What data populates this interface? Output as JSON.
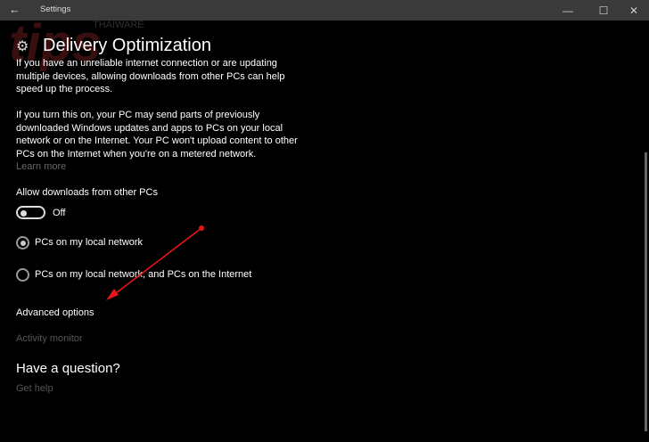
{
  "window": {
    "title": "Settings",
    "back": "←",
    "minimize": "—",
    "maximize": "☐",
    "close": "✕"
  },
  "watermark": {
    "brand": "THAIWARE",
    "logo": "tips"
  },
  "page": {
    "title": "Delivery Optimization",
    "para1": [
      "If you have an unreliable internet connection or are updating",
      "multiple devices, allowing downloads from other PCs can help",
      "speed up the process."
    ],
    "para2": [
      "If you turn this on, your PC may send parts of previously",
      "downloaded Windows updates and apps to PCs on your local",
      "network or on the Internet. Your PC won't upload content to other",
      "PCs on the Internet when you're on a metered network."
    ],
    "learn_more": "Learn more",
    "allow_label": "Allow downloads from other PCs",
    "toggle": {
      "state": "Off",
      "on": false
    },
    "radios": [
      {
        "label": "PCs on my local network",
        "selected": true
      },
      {
        "label": "PCs on my local network, and PCs on the Internet",
        "selected": false
      }
    ],
    "advanced": "Advanced options",
    "activity": "Activity monitor",
    "question": "Have a question?",
    "help": "Get help"
  },
  "annotation": {
    "color": "#e8141c"
  }
}
